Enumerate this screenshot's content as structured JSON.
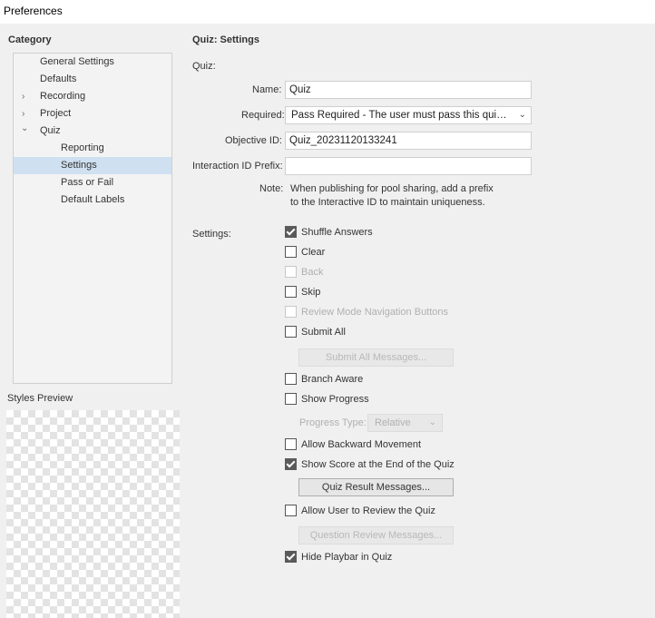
{
  "window": {
    "title": "Preferences"
  },
  "category": {
    "label": "Category",
    "items": [
      {
        "label": "General Settings",
        "caret": ""
      },
      {
        "label": "Defaults",
        "caret": ""
      },
      {
        "label": "Recording",
        "caret": "›"
      },
      {
        "label": "Project",
        "caret": "›"
      },
      {
        "label": "Quiz",
        "caret": "⌄"
      },
      {
        "label": "Reporting",
        "caret": ""
      },
      {
        "label": "Settings",
        "caret": ""
      },
      {
        "label": "Pass or Fail",
        "caret": ""
      },
      {
        "label": "Default Labels",
        "caret": ""
      }
    ],
    "selected": "Settings"
  },
  "styles_preview": {
    "label": "Styles Preview"
  },
  "main": {
    "title": "Quiz: Settings",
    "quiz_heading": "Quiz:",
    "name_label": "Name:",
    "name_value": "Quiz",
    "required_label": "Required:",
    "required_value": "Pass Required - The user must pass this quiz to ...",
    "objective_label": "Objective ID:",
    "objective_value": "Quiz_20231120133241",
    "interaction_label": "Interaction ID Prefix:",
    "interaction_value": "",
    "note_label": "Note:",
    "note_line1": "When publishing for pool sharing, add a prefix",
    "note_line2": "to the Interactive ID to maintain uniqueness.",
    "settings_label": "Settings:",
    "options": {
      "shuffle_answers": {
        "label": "Shuffle Answers",
        "checked": true,
        "enabled": true
      },
      "clear": {
        "label": "Clear",
        "checked": false,
        "enabled": true
      },
      "back": {
        "label": "Back",
        "checked": false,
        "enabled": false
      },
      "skip": {
        "label": "Skip",
        "checked": false,
        "enabled": true
      },
      "review_nav": {
        "label": "Review Mode Navigation Buttons",
        "checked": false,
        "enabled": false
      },
      "submit_all": {
        "label": "Submit All",
        "checked": false,
        "enabled": true
      },
      "branch_aware": {
        "label": "Branch Aware",
        "checked": false,
        "enabled": true
      },
      "show_progress": {
        "label": "Show Progress",
        "checked": false,
        "enabled": true
      },
      "allow_backward": {
        "label": "Allow Backward Movement",
        "checked": false,
        "enabled": true
      },
      "show_score": {
        "label": "Show Score at the End of the Quiz",
        "checked": true,
        "enabled": true
      },
      "allow_review": {
        "label": "Allow User to Review the Quiz",
        "checked": false,
        "enabled": true
      },
      "hide_playbar": {
        "label": "Hide Playbar in Quiz",
        "checked": true,
        "enabled": true
      }
    },
    "submit_all_messages_button": "Submit All Messages...",
    "progress_type_label": "Progress Type:",
    "progress_type_value": "Relative",
    "quiz_result_messages_button": "Quiz Result Messages...",
    "question_review_messages_button": "Question Review Messages..."
  }
}
